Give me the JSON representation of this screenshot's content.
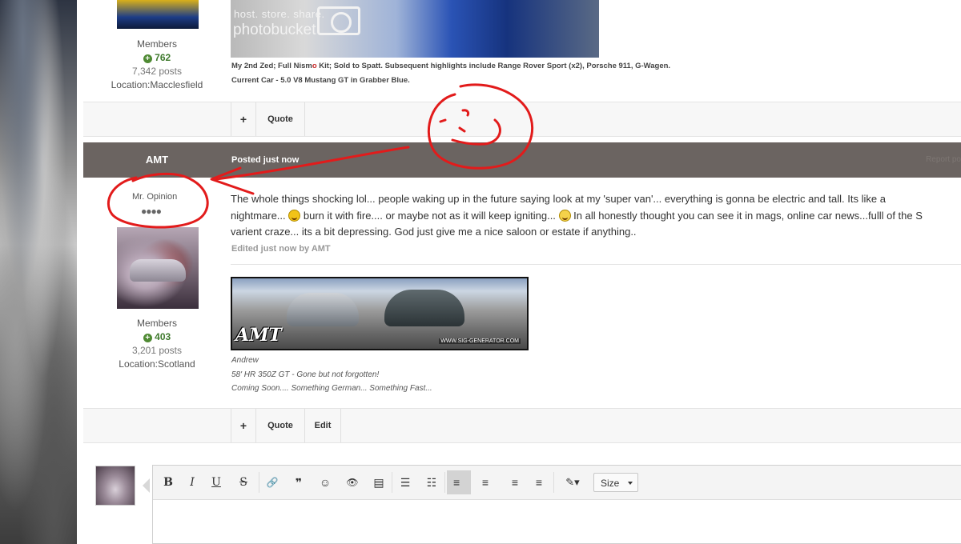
{
  "post1": {
    "author": {
      "group": "Members",
      "reputation": "762",
      "posts": "7,342 posts",
      "location": "Location:Macclesfield"
    },
    "signature_image": {
      "watermark_line1": "host. store. share.",
      "watermark_line2": "photobucket"
    },
    "signature_line1_pre": "My 2nd Zed; Full Nism",
    "signature_line1_red": "o",
    "signature_line1_post": " Kit; Sold to Spatt. Subsequent highlights include Range Rover Sport (x2), Porsche 911, G-Wagen.",
    "signature_line2": "Current Car - 5.0 V8 Mustang GT in Grabber Blue.",
    "actions": {
      "plus": "+",
      "quote": "Quote"
    }
  },
  "post2": {
    "author_name": "AMT",
    "posted": "Posted just now",
    "report": "Report po",
    "author": {
      "title": "Mr. Opinion",
      "rank_dots": "●●●●",
      "group": "Members",
      "reputation": "403",
      "posts": "3,201 posts",
      "location": "Location:Scotland"
    },
    "body_line1": "The whole things shocking lol...  people waking up in the future saying look at my 'super van'... everything is gonna be electric and tall.  Its like a",
    "body_line2a": "nightmare...",
    "body_line2b": " burn it with fire.... or maybe not as it will keep igniting... ",
    "body_line2c": " In all honestly thought you can see it in mags, online car news...fulll of the S",
    "body_line3": "varient craze... its a bit depressing.  God just give me a nice saloon or estate if anything..",
    "edited": "Edited just now by AMT",
    "signature_image": {
      "watermark": "AMT",
      "site": "WWW.SIG-GENERATOR.COM"
    },
    "signature_lines": [
      "Andrew",
      "58' HR 350Z GT - Gone but not forgotten!",
      "Coming Soon.... Something German... Something Fast..."
    ],
    "actions": {
      "plus": "+",
      "quote": "Quote",
      "edit": "Edit"
    }
  },
  "editor": {
    "toolbar": {
      "bold": "B",
      "italic": "I",
      "underline": "U",
      "strike": "S",
      "link": "🔗",
      "quote": "❞",
      "emoticon": "☺",
      "preview": "👁",
      "source": "▤",
      "bullet_list": "☰",
      "numbered_list": "☷",
      "align_left": "≡",
      "align_center": "≡",
      "align_right": "≡",
      "justify": "≡",
      "color": "✎▾",
      "size": "Size"
    },
    "active_button": "align_left"
  },
  "annotations": {
    "color": "#e21b1b"
  }
}
